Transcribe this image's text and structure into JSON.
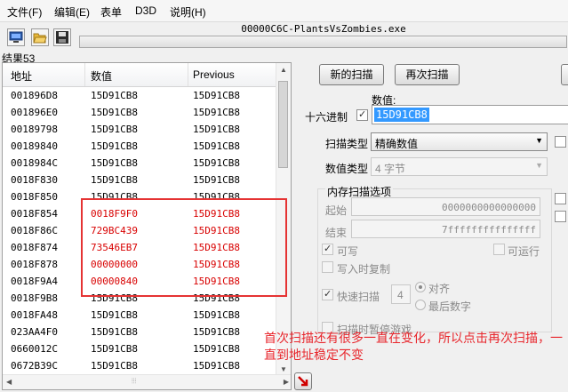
{
  "menu": {
    "items": [
      "文件(F)",
      "编辑(E)",
      "表单",
      "D3D",
      "说明(H)"
    ]
  },
  "process_title": "00000C6C-PlantsVsZombies.exe",
  "results_count": "结果53",
  "list": {
    "columns": [
      "地址",
      "数值",
      "Previous"
    ],
    "rows": [
      {
        "address": "001896D8",
        "value": "15D91CB8",
        "previous": "15D91CB8",
        "changed": false
      },
      {
        "address": "001896E0",
        "value": "15D91CB8",
        "previous": "15D91CB8",
        "changed": false
      },
      {
        "address": "00189798",
        "value": "15D91CB8",
        "previous": "15D91CB8",
        "changed": false
      },
      {
        "address": "00189840",
        "value": "15D91CB8",
        "previous": "15D91CB8",
        "changed": false
      },
      {
        "address": "0018984C",
        "value": "15D91CB8",
        "previous": "15D91CB8",
        "changed": false
      },
      {
        "address": "0018F830",
        "value": "15D91CB8",
        "previous": "15D91CB8",
        "changed": false
      },
      {
        "address": "0018F850",
        "value": "15D91CB8",
        "previous": "15D91CB8",
        "changed": false
      },
      {
        "address": "0018F854",
        "value": "0018F9F0",
        "previous": "15D91CB8",
        "changed": true
      },
      {
        "address": "0018F86C",
        "value": "729BC439",
        "previous": "15D91CB8",
        "changed": true
      },
      {
        "address": "0018F874",
        "value": "73546EB7",
        "previous": "15D91CB8",
        "changed": true
      },
      {
        "address": "0018F878",
        "value": "00000000",
        "previous": "15D91CB8",
        "changed": true
      },
      {
        "address": "0018F9A4",
        "value": "00000840",
        "previous": "15D91CB8",
        "changed": true
      },
      {
        "address": "0018F9B8",
        "value": "15D91CB8",
        "previous": "15D91CB8",
        "changed": false
      },
      {
        "address": "0018FA48",
        "value": "15D91CB8",
        "previous": "15D91CB8",
        "changed": false
      },
      {
        "address": "023AA4F0",
        "value": "15D91CB8",
        "previous": "15D91CB8",
        "changed": false
      },
      {
        "address": "0660012C",
        "value": "15D91CB8",
        "previous": "15D91CB8",
        "changed": false
      },
      {
        "address": "0672B39C",
        "value": "15D91CB8",
        "previous": "15D91CB8",
        "changed": false
      }
    ]
  },
  "scan": {
    "new_scan": "新的扫描",
    "next_scan": "再次扫描",
    "value_label": "数值:",
    "hex_label": "十六进制",
    "value_input": "15D91CB8",
    "scan_type_label": "扫描类型",
    "scan_type_value": "精确数值",
    "value_type_label": "数值类型",
    "value_type_value": "4 字节"
  },
  "memory_options": {
    "title": "内存扫描选项",
    "start_label": "起始",
    "start_value": "0000000000000000",
    "end_label": "结束",
    "end_value": "7fffffffffffffff",
    "writable": "可写",
    "executable": "可运行",
    "copy_on_write": "写入时复制",
    "fast_scan": "快速扫描",
    "fast_scan_value": "4",
    "align": "对齐",
    "last_digits": "最后数字",
    "pause_game": "扫描时暂停游戏"
  },
  "annotation": "首次扫描还有很多一直在变化，所以点击再次扫描，一直到地址稳定不变",
  "colors": {
    "highlight": "#e53333",
    "changed_value": "#d80000",
    "annotation": "#e8262c",
    "selection": "#3399ff"
  }
}
